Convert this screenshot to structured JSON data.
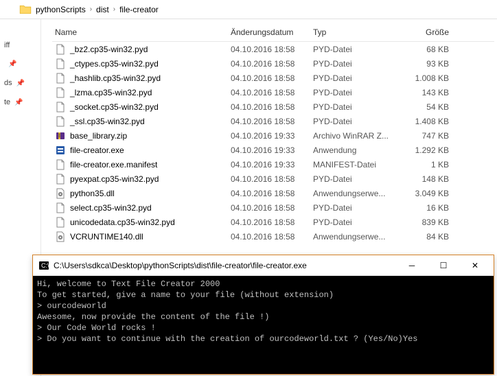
{
  "breadcrumb": [
    "pythonScripts",
    "dist",
    "file-creator"
  ],
  "sidebar": {
    "items": [
      {
        "label": "iff"
      },
      {
        "label": "ds"
      },
      {
        "label": "te"
      }
    ]
  },
  "columns": {
    "name": "Name",
    "date": "Änderungsdatum",
    "type": "Typ",
    "size": "Größe"
  },
  "files": [
    {
      "icon": "file",
      "name": "_bz2.cp35-win32.pyd",
      "date": "04.10.2016 18:58",
      "type": "PYD-Datei",
      "size": "68 KB"
    },
    {
      "icon": "file",
      "name": "_ctypes.cp35-win32.pyd",
      "date": "04.10.2016 18:58",
      "type": "PYD-Datei",
      "size": "93 KB"
    },
    {
      "icon": "file",
      "name": "_hashlib.cp35-win32.pyd",
      "date": "04.10.2016 18:58",
      "type": "PYD-Datei",
      "size": "1.008 KB"
    },
    {
      "icon": "file",
      "name": "_lzma.cp35-win32.pyd",
      "date": "04.10.2016 18:58",
      "type": "PYD-Datei",
      "size": "143 KB"
    },
    {
      "icon": "file",
      "name": "_socket.cp35-win32.pyd",
      "date": "04.10.2016 18:58",
      "type": "PYD-Datei",
      "size": "54 KB"
    },
    {
      "icon": "file",
      "name": "_ssl.cp35-win32.pyd",
      "date": "04.10.2016 18:58",
      "type": "PYD-Datei",
      "size": "1.408 KB"
    },
    {
      "icon": "zip",
      "name": "base_library.zip",
      "date": "04.10.2016 19:33",
      "type": "Archivo WinRAR Z...",
      "size": "747 KB"
    },
    {
      "icon": "exe",
      "name": "file-creator.exe",
      "date": "04.10.2016 19:33",
      "type": "Anwendung",
      "size": "1.292 KB"
    },
    {
      "icon": "file",
      "name": "file-creator.exe.manifest",
      "date": "04.10.2016 19:33",
      "type": "MANIFEST-Datei",
      "size": "1 KB"
    },
    {
      "icon": "file",
      "name": "pyexpat.cp35-win32.pyd",
      "date": "04.10.2016 18:58",
      "type": "PYD-Datei",
      "size": "148 KB"
    },
    {
      "icon": "dll",
      "name": "python35.dll",
      "date": "04.10.2016 18:58",
      "type": "Anwendungserwe...",
      "size": "3.049 KB"
    },
    {
      "icon": "file",
      "name": "select.cp35-win32.pyd",
      "date": "04.10.2016 18:58",
      "type": "PYD-Datei",
      "size": "16 KB"
    },
    {
      "icon": "file",
      "name": "unicodedata.cp35-win32.pyd",
      "date": "04.10.2016 18:58",
      "type": "PYD-Datei",
      "size": "839 KB"
    },
    {
      "icon": "dll",
      "name": "VCRUNTIME140.dll",
      "date": "04.10.2016 18:58",
      "type": "Anwendungserwe...",
      "size": "84 KB"
    }
  ],
  "console": {
    "title": "C:\\Users\\sdkca\\Desktop\\pythonScripts\\dist\\file-creator\\file-creator.exe",
    "lines": [
      "Hi, welcome to Text File Creator 2000",
      "To get started, give a name to your file (without extension)",
      "> ourcodeworld",
      "Awesome, now provide the content of the file !)",
      "> Our Code World rocks !",
      "> Do you want to continue with the creation of ourcodeworld.txt ? (Yes/No)Yes"
    ]
  }
}
